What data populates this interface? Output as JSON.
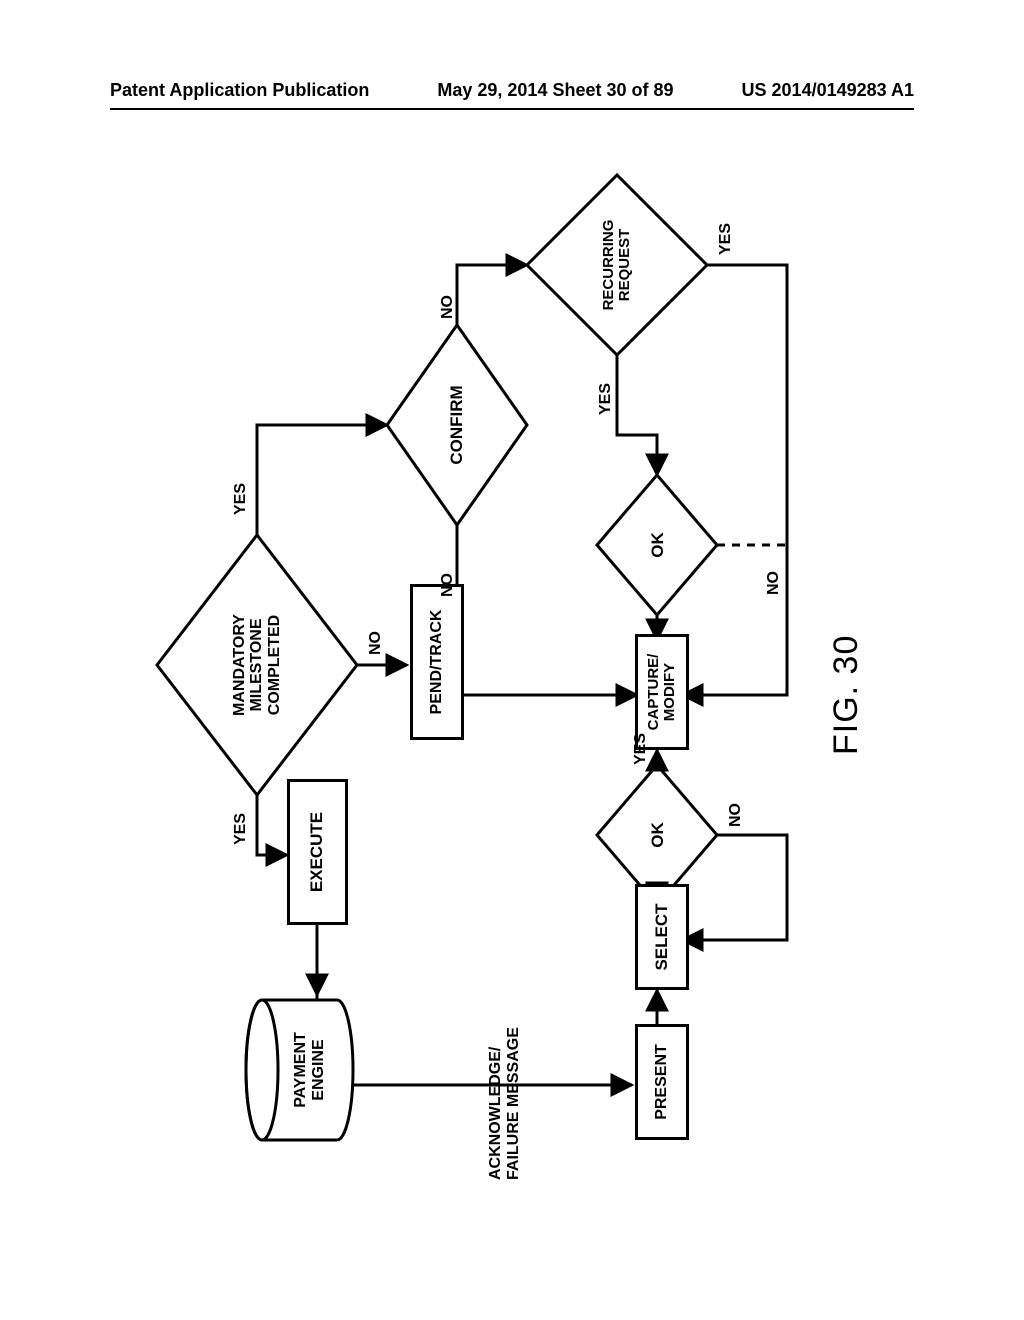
{
  "header": {
    "left": "Patent Application Publication",
    "center": "May 29, 2014  Sheet 30 of 89",
    "right": "US 2014/0149283 A1"
  },
  "nodes": {
    "milestone": "MANDATORY\nMILESTONE\nCOMPLETED",
    "pend": "PEND/TRACK",
    "execute": "EXECUTE",
    "payment": "PAYMENT\nENGINE",
    "confirm": "CONFIRM",
    "recurring": "RECURRING\nREQUEST",
    "ok1": "OK",
    "ok2": "OK",
    "capture": "CAPTURE/\nMODIFY",
    "select": "SELECT",
    "present": "PRESENT"
  },
  "labels": {
    "yes1": "YES",
    "yes2": "YES",
    "yes3": "YES",
    "yes4": "YES",
    "yes5": "YES",
    "no1": "NO",
    "no2": "NO",
    "no3": "NO",
    "no4": "NO",
    "no5": "NO",
    "ack": "ACKNOWLEDGE/\nFAILURE MESSAGE"
  },
  "caption": "FIG. 30"
}
